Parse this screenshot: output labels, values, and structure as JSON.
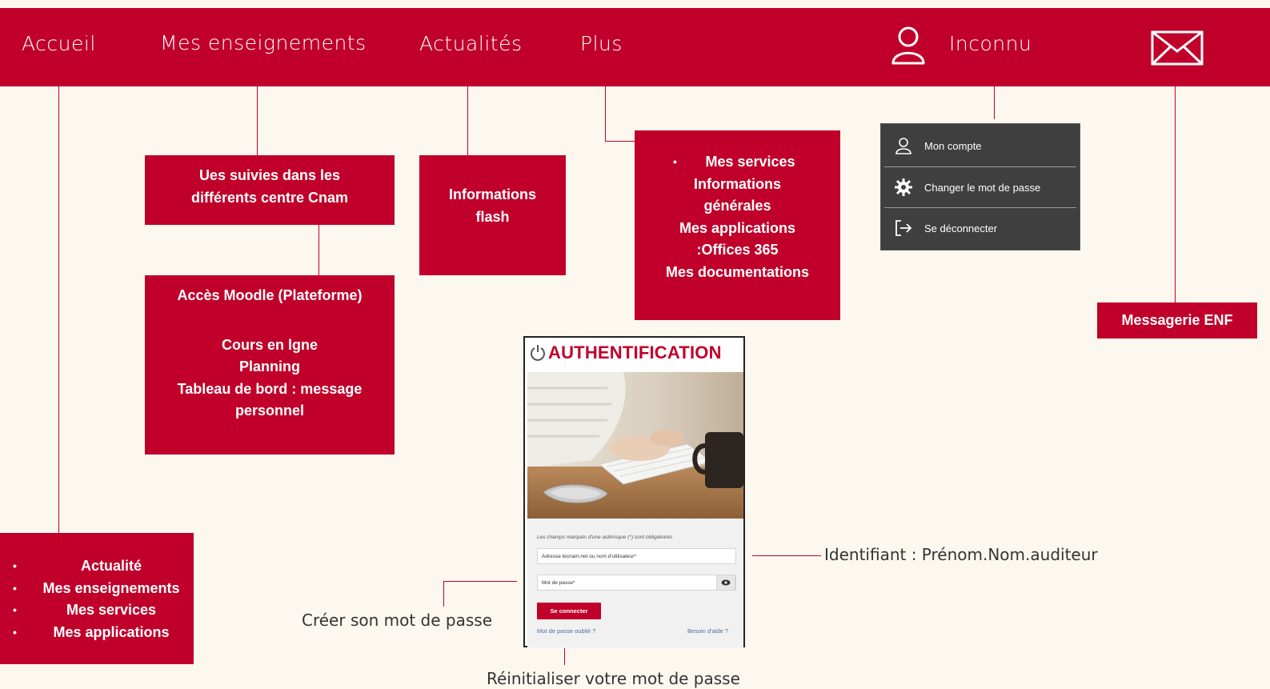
{
  "nav": {
    "accueil": "Accueil",
    "enseignements": "Mes enseignements",
    "actualites": "Actualités",
    "plus": "Plus",
    "user": "Inconnu"
  },
  "boxes": {
    "suivies": [
      "Ues suivies dans les",
      "différents centre Cnam"
    ],
    "moodle": {
      "title": "Accès Moodle (Plateforme)",
      "items": [
        "Cours en lgne",
        "Planning",
        "Tableau de bord : message",
        "personnel"
      ]
    },
    "flash": [
      "Informations",
      "flash"
    ],
    "plus": {
      "first": "Mes services",
      "items": [
        "Informations",
        "générales",
        "Mes applications",
        ":Offices 365",
        "Mes documentations"
      ]
    },
    "accueil": [
      "Actualité",
      "Mes enseignements",
      "Mes services",
      "Mes applications"
    ],
    "messagerie": "Messagerie ENF"
  },
  "user_menu": {
    "items": [
      "Mon compte",
      "Changer le mot de passe",
      "Se déconnecter"
    ]
  },
  "auth": {
    "title": "AUTHENTIFICATION",
    "required_note": "Les champs marqués d'une astérisque (*) sont obligatoires",
    "login_placeholder": "Adresse lecnam.net ou nom d'utilisateur*",
    "password_placeholder": "Mot de passe*",
    "submit": "Se connecter",
    "forgot": "Mot de passe oublié ?",
    "help": "Besoin d'aide ?"
  },
  "captions": {
    "identifiant": "Identifiant : Prénom.Nom.auditeur",
    "creer": "Créer son mot de passe",
    "reinit": "Réinitialiser votre mot de passe"
  },
  "colors": {
    "brand": "#c0002a",
    "background": "#fdf8ef",
    "menu": "#3f3f3f"
  }
}
